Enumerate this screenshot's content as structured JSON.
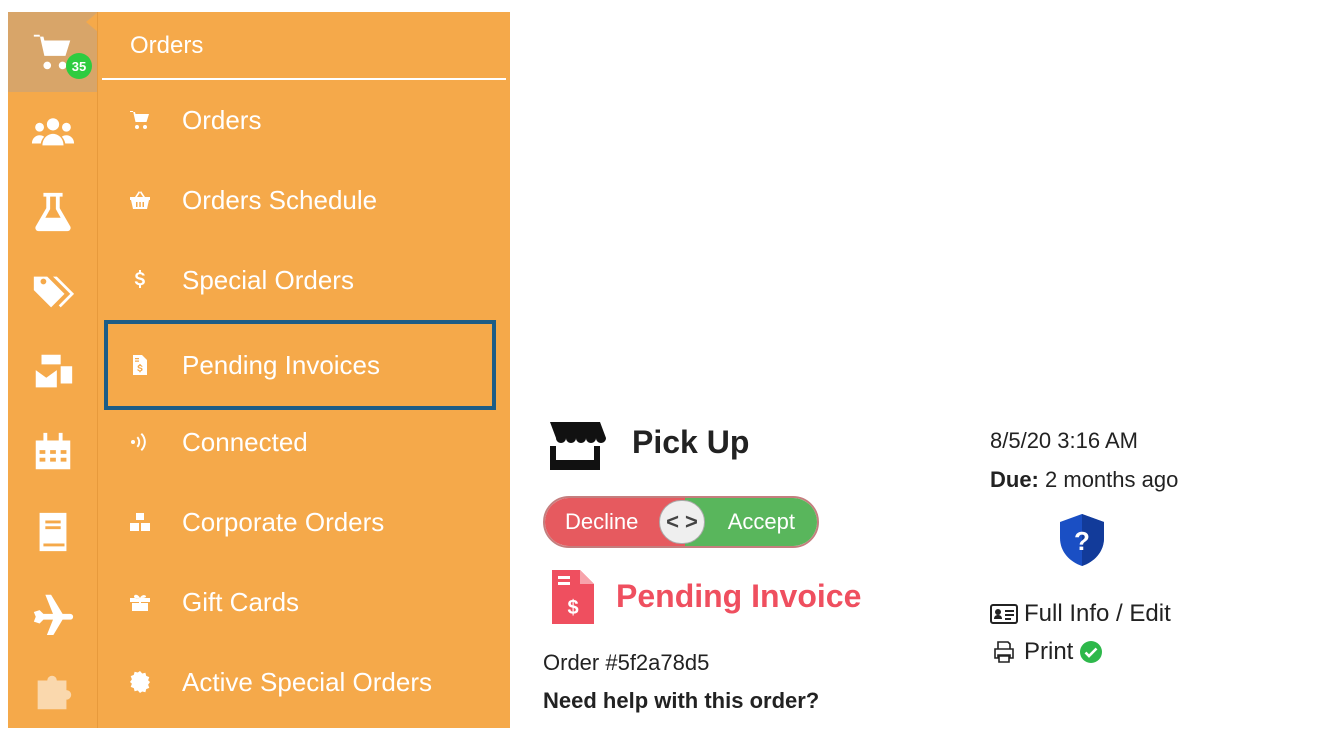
{
  "rail": {
    "cart_badge": "35",
    "items": [
      "cart-icon",
      "users-icon",
      "flask-icon",
      "tags-icon",
      "mail-bulk-icon",
      "calendar-icon",
      "book-icon",
      "plane-icon",
      "puzzle-icon"
    ]
  },
  "menu": {
    "header": "Orders",
    "items": [
      {
        "label": "Orders",
        "icon": "cart-icon"
      },
      {
        "label": "Orders Schedule",
        "icon": "basket-icon"
      },
      {
        "label": "Special Orders",
        "icon": "dollar-icon"
      },
      {
        "label": "Pending Invoices",
        "icon": "invoice-icon"
      },
      {
        "label": "Connected",
        "icon": "signal-icon"
      },
      {
        "label": "Corporate Orders",
        "icon": "boxes-icon"
      },
      {
        "label": "Gift Cards",
        "icon": "gift-icon"
      },
      {
        "label": "Active Special Orders",
        "icon": "certificate-icon"
      }
    ]
  },
  "order": {
    "type": "Pick Up",
    "decline_label": "Decline",
    "accept_label": "Accept",
    "knob_label": "< >",
    "status": "Pending Invoice",
    "order_number": "Order #5f2a78d5",
    "help": "Need help with this order?",
    "date": "8/5/20 3:16 AM",
    "due_label": "Due:",
    "due_value": "2 months ago",
    "full_info_label": "Full Info / Edit",
    "print_label": "Print"
  },
  "colors": {
    "sidebar": "#f5a94a",
    "selected_outline": "#1d5c86",
    "decline": "#e65a5f",
    "accept": "#59b65c",
    "pending": "#ef4f5f",
    "shield": "#1a4fc4"
  }
}
